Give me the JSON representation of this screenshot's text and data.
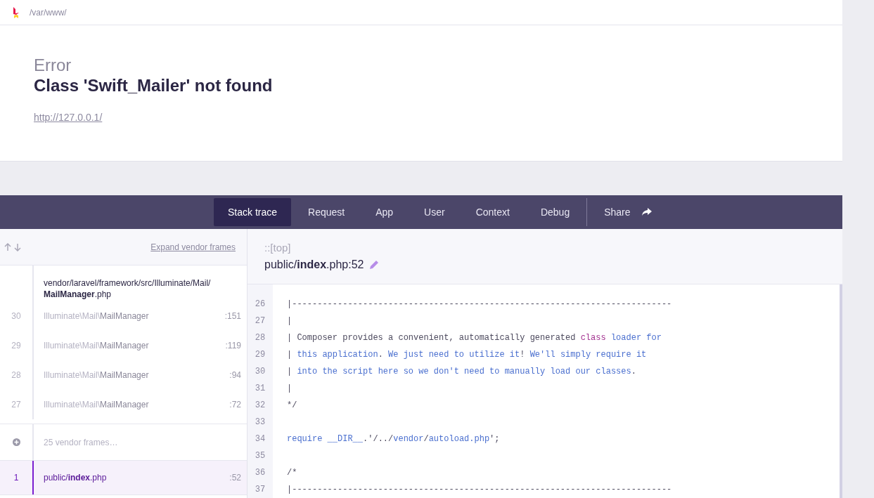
{
  "header": {
    "path": "/var/www/"
  },
  "error": {
    "type": "Error",
    "message": "Class 'Swift_Mailer' not found",
    "url": "http://127.0.0.1/"
  },
  "tabs": [
    {
      "label": "Stack trace",
      "selected": true
    },
    {
      "label": "Request",
      "selected": false
    },
    {
      "label": "App",
      "selected": false
    },
    {
      "label": "User",
      "selected": false
    },
    {
      "label": "Context",
      "selected": false
    },
    {
      "label": "Debug",
      "selected": false
    }
  ],
  "share": {
    "label": "Share"
  },
  "sidebar": {
    "expand_link": "Expand vendor frames",
    "items": [
      {
        "kind": "file",
        "dir": "vendor/laravel/framework/src/Illuminate/Mail/",
        "file": "**MailManager**.php"
      },
      {
        "kind": "frame",
        "number": "30",
        "namespace": "Illuminate\\Mail\\",
        "class": "MailManager",
        "line": ":151",
        "selected": false
      },
      {
        "kind": "frame",
        "number": "29",
        "namespace": "Illuminate\\Mail\\",
        "class": "MailManager",
        "line": ":119",
        "selected": false
      },
      {
        "kind": "frame",
        "number": "28",
        "namespace": "Illuminate\\Mail\\",
        "class": "MailManager",
        "line": ":94",
        "selected": false
      },
      {
        "kind": "frame",
        "number": "27",
        "namespace": "Illuminate\\Mail\\",
        "class": "MailManager",
        "line": ":72",
        "selected": false
      },
      {
        "kind": "collapsed",
        "text": "25 vendor frames…"
      },
      {
        "kind": "app_frame",
        "number": "1",
        "path": "public/**index**.php",
        "line": ":52",
        "selected": true
      }
    ]
  },
  "code": {
    "context": "::[top]",
    "file": "public/**index**.php:52",
    "lines": [
      {
        "number": "26",
        "tokens": [
          {
            "text": "|---------------------------------------------------------------------------",
            "kind": "plain"
          }
        ]
      },
      {
        "number": "27",
        "tokens": [
          {
            "text": "|",
            "kind": "plain"
          }
        ]
      },
      {
        "number": "28",
        "tokens": [
          {
            "text": "| Composer provides a convenient, automatically generated ",
            "kind": "plain"
          },
          {
            "text": "class",
            "kind": "keyword"
          },
          {
            "text": " loader for",
            "kind": "ident"
          }
        ]
      },
      {
        "number": "29",
        "tokens": [
          {
            "text": "| ",
            "kind": "plain"
          },
          {
            "text": "this application",
            "kind": "ident"
          },
          {
            "text": ". ",
            "kind": "plain"
          },
          {
            "text": "We just need to utilize it",
            "kind": "ident"
          },
          {
            "text": "! ",
            "kind": "plain"
          },
          {
            "text": "We'll simply require it",
            "kind": "ident"
          }
        ]
      },
      {
        "number": "30",
        "tokens": [
          {
            "text": "| ",
            "kind": "plain"
          },
          {
            "text": "into the script here so we don't need to manually load our classes",
            "kind": "ident"
          },
          {
            "text": ".",
            "kind": "plain"
          }
        ]
      },
      {
        "number": "31",
        "tokens": [
          {
            "text": "|",
            "kind": "plain"
          }
        ]
      },
      {
        "number": "32",
        "tokens": [
          {
            "text": "*/",
            "kind": "plain"
          }
        ]
      },
      {
        "number": "33"
      },
      {
        "number": "34",
        "tokens": [
          {
            "text": "require __DIR__",
            "kind": "ident"
          },
          {
            "text": ".'/../",
            "kind": "plain"
          },
          {
            "text": "vendor",
            "kind": "ident"
          },
          {
            "text": "/",
            "kind": "plain"
          },
          {
            "text": "autoload.php",
            "kind": "ident"
          },
          {
            "text": "';",
            "kind": "plain"
          }
        ]
      },
      {
        "number": "35"
      },
      {
        "number": "36",
        "tokens": [
          {
            "text": "/*",
            "kind": "plain"
          }
        ]
      },
      {
        "number": "37",
        "tokens": [
          {
            "text": "|---------------------------------------------------------------------------",
            "kind": "plain"
          }
        ]
      }
    ]
  }
}
